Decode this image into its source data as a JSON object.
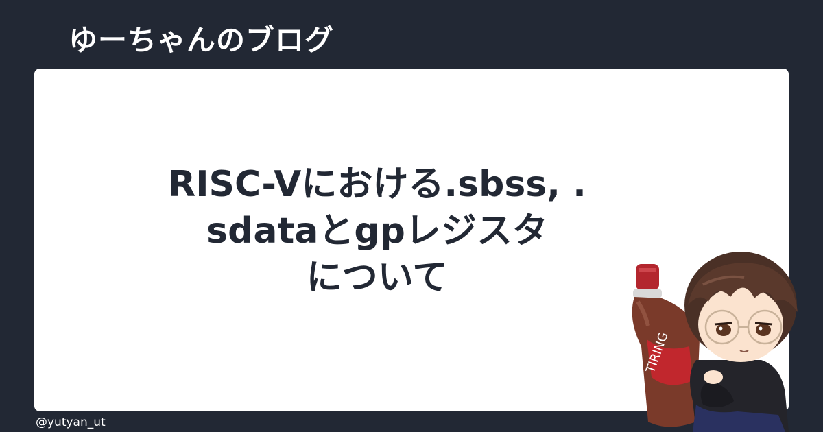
{
  "header": {
    "blog_name": "ゆーちゃんのブログ"
  },
  "post": {
    "title_lines": [
      "RISC-Vにおける.sbss, .",
      "sdataとgpレジスタ",
      "について"
    ]
  },
  "footer": {
    "author_handle": "@yutyan_ut"
  },
  "mascot": {
    "bottle_label": "TIRING"
  },
  "colors": {
    "background": "#222834",
    "card": "#ffffff",
    "title_text": "#222834",
    "header_text": "#ffffff"
  }
}
